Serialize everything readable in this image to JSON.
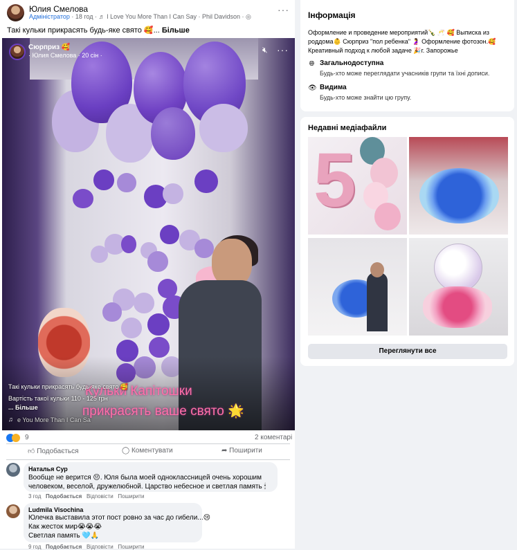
{
  "post": {
    "author": "Юлия Смелова",
    "role": "Адміністратор",
    "time": "· 18 год ·",
    "music": "♬ I Love You More Than I Can Say · Phil Davidson ·",
    "text": "Такі кульки прикрасять будь-яке свято 🥰...",
    "more": "Більше",
    "more_icon": "three-dots-icon"
  },
  "video": {
    "title": "Сюрприз 🥰",
    "sub": "· Юлия Смелова · 20 сін ·",
    "caption_line1": "Такі кульки прикрасять будь-яке свято 🥰",
    "caption_line2": "Вартість такої кульки 110 - 125 грн",
    "caption_more": "... Більше",
    "music": "e You More Than I Can Sa",
    "overlay_line1": "Кульки Капітошки",
    "overlay_line2": "прикрасять ваше свято 🌟"
  },
  "stats": {
    "reactions": "9",
    "comments": "2 коментарі"
  },
  "actions": {
    "like": "Подобається",
    "comment": "Коментувати",
    "share": "Поширити"
  },
  "comments": [
    {
      "name": "Наталья Сур",
      "lines": [
        "Вообще не верится 😔. Юля была моей одноклассницей очень хорошим",
        "человеком, веселой, дружелюбной. Царство небесное и светлая память 🕯"
      ],
      "time": "3 год",
      "like": "Подобається",
      "reply": "Відповісти",
      "share": "Поширити"
    },
    {
      "name": "Ludmila Visochina",
      "lines": [
        "Юлечка выставила этот пост ровно за час до гибели...😢",
        "Как жесток мир😭😭😭",
        "Светлая память 🩵🙏"
      ],
      "time": "9 год",
      "like": "Подобається",
      "reply": "Відповісти",
      "share": "Поширити"
    }
  ],
  "info": {
    "title": "Інформація",
    "description": "Оформление и проведение мероприятий🍾 🥂 🥰 Выписка из роддома👶 Сюрприз \"пол ребенка\" 🤰 Оформление фотозон.🥰 Креативный подход к любой задаче 🎉г. Запорожье",
    "public_title": "Загальнодоступна",
    "public_sub": "Будь-хто може переглядати учасників групи та їхні дописи.",
    "visible_title": "Видима",
    "visible_sub": "Будь-хто може знайти цю групу."
  },
  "media": {
    "title": "Недавні медіафайли",
    "view_all": "Переглянути все"
  },
  "colors": {
    "link": "#216fdb",
    "like_blue": "#1877f2",
    "balloon_purple": "#6a3fc2",
    "balloon_lilac": "#c8b8e8",
    "overlay_pink": "#ff6fa8"
  }
}
